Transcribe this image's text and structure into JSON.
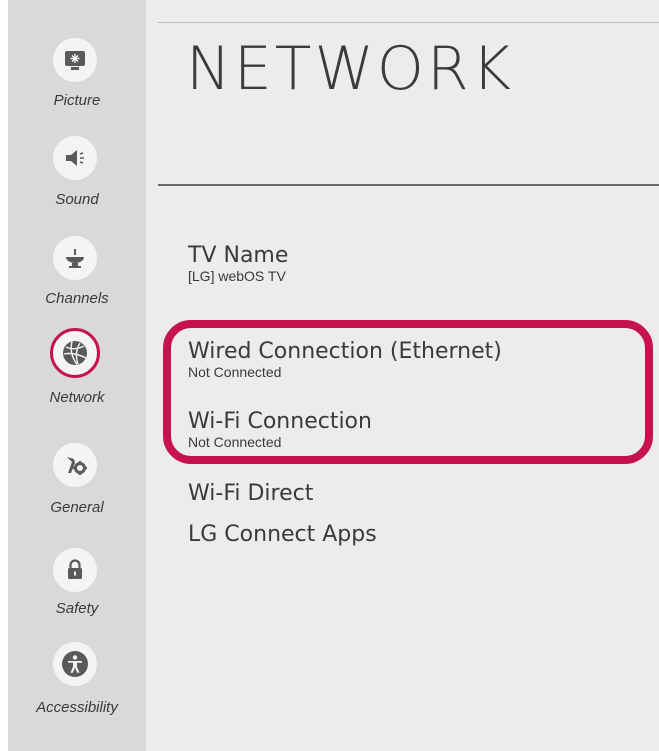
{
  "page": {
    "title": "NETWORK"
  },
  "sidebar": {
    "items": [
      {
        "label": "Picture",
        "icon": "picture-icon"
      },
      {
        "label": "Sound",
        "icon": "sound-icon"
      },
      {
        "label": "Channels",
        "icon": "channels-icon"
      },
      {
        "label": "Network",
        "icon": "network-icon",
        "selected": true
      },
      {
        "label": "General",
        "icon": "general-icon"
      },
      {
        "label": "Safety",
        "icon": "lock-icon"
      },
      {
        "label": "Accessibility",
        "icon": "accessibility-icon"
      }
    ]
  },
  "menu": {
    "items": [
      {
        "title": "TV Name",
        "subtitle": "[LG] webOS TV"
      },
      {
        "title": "Wired Connection (Ethernet)",
        "subtitle": "Not Connected"
      },
      {
        "title": "Wi-Fi Connection",
        "subtitle": "Not Connected"
      },
      {
        "title": "Wi-Fi Direct"
      },
      {
        "title": "LG Connect Apps"
      }
    ]
  },
  "colors": {
    "highlight": "#c6124f",
    "sidebar_bg": "#d9d9d9",
    "main_bg": "#ececec",
    "icon_gray": "#5a5a5a"
  }
}
